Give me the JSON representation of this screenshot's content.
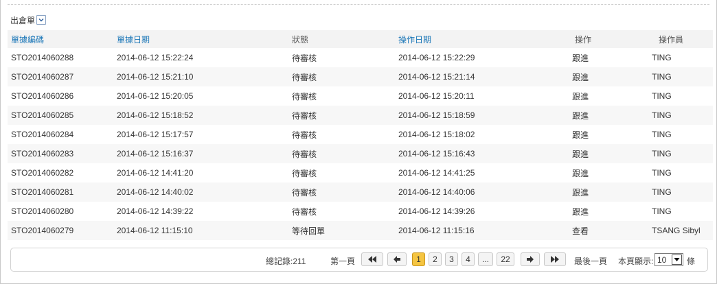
{
  "filter": {
    "type_label": "出倉單",
    "type_select_icon": "chevron-down-icon"
  },
  "table": {
    "headers": {
      "doc_no": "單據編碼",
      "doc_date": "單據日期",
      "status": "狀態",
      "op_date": "操作日期",
      "action": "操作",
      "operator": "操作員"
    },
    "rows": [
      {
        "doc_no": "STO2014060288",
        "doc_date": "2014-06-12 15:22:24",
        "status": "待審核",
        "op_date": "2014-06-12 15:22:29",
        "action": "跟進",
        "operator": "TING"
      },
      {
        "doc_no": "STO2014060287",
        "doc_date": "2014-06-12 15:21:10",
        "status": "待審核",
        "op_date": "2014-06-12 15:21:14",
        "action": "跟進",
        "operator": "TING"
      },
      {
        "doc_no": "STO2014060286",
        "doc_date": "2014-06-12 15:20:05",
        "status": "待審核",
        "op_date": "2014-06-12 15:20:11",
        "action": "跟進",
        "operator": "TING"
      },
      {
        "doc_no": "STO2014060285",
        "doc_date": "2014-06-12 15:18:52",
        "status": "待審核",
        "op_date": "2014-06-12 15:18:59",
        "action": "跟進",
        "operator": "TING"
      },
      {
        "doc_no": "STO2014060284",
        "doc_date": "2014-06-12 15:17:57",
        "status": "待審核",
        "op_date": "2014-06-12 15:18:02",
        "action": "跟進",
        "operator": "TING"
      },
      {
        "doc_no": "STO2014060283",
        "doc_date": "2014-06-12 15:16:37",
        "status": "待審核",
        "op_date": "2014-06-12 15:16:43",
        "action": "跟進",
        "operator": "TING"
      },
      {
        "doc_no": "STO2014060282",
        "doc_date": "2014-06-12 14:41:20",
        "status": "待審核",
        "op_date": "2014-06-12 14:41:25",
        "action": "跟進",
        "operator": "TING"
      },
      {
        "doc_no": "STO2014060281",
        "doc_date": "2014-06-12 14:40:02",
        "status": "待審核",
        "op_date": "2014-06-12 14:40:06",
        "action": "跟進",
        "operator": "TING"
      },
      {
        "doc_no": "STO2014060280",
        "doc_date": "2014-06-12 14:39:22",
        "status": "待審核",
        "op_date": "2014-06-12 14:39:26",
        "action": "跟進",
        "operator": "TING"
      },
      {
        "doc_no": "STO2014060279",
        "doc_date": "2014-06-12 11:15:10",
        "status": "等待回單",
        "op_date": "2014-06-12 11:15:16",
        "action": "查看",
        "operator": "TSANG Sibyl"
      }
    ]
  },
  "pager": {
    "total_label": "總記錄:211",
    "first_label": "第一頁",
    "last_label": "最後一頁",
    "pages": [
      "1",
      "2",
      "3",
      "4",
      "...",
      "22"
    ],
    "current_page": "1",
    "per_page_label": "本頁顯示:",
    "per_page_value": "10",
    "per_page_unit": "條",
    "icons": {
      "first": "double-arrow-left-icon",
      "prev": "arrow-left-icon",
      "next": "arrow-right-icon",
      "last": "double-arrow-right-icon"
    }
  }
}
